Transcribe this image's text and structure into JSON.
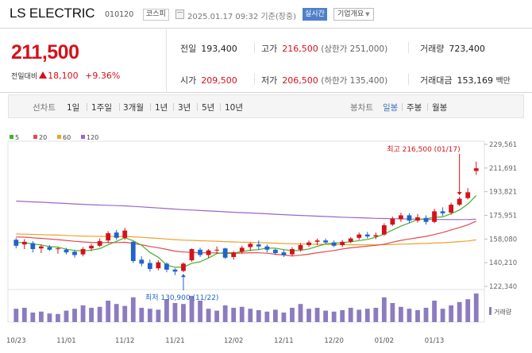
{
  "header": {
    "name": "LS ELECTRIC",
    "code": "010120",
    "market": "코스피",
    "timestamp": "2025.01.17 09:32 기준(장중)",
    "realtime_label": "실시간",
    "company_label": "기업개요"
  },
  "quote": {
    "price": "211,500",
    "change_label": "전일대비",
    "change": "18,100",
    "change_pct": "+9.36%",
    "prev_label": "전일",
    "prev": "193,400",
    "high_label": "고가",
    "high": "216,500",
    "upper_limit": "(상한가 251,000)",
    "volume_label": "거래량",
    "volume": "723,400",
    "open_label": "시가",
    "open": "209,500",
    "low_label": "저가",
    "low": "206,500",
    "lower_limit": "(하한가 135,400)",
    "value_label": "거래대금",
    "value": "153,169",
    "value_unit": "백만"
  },
  "tabs": {
    "line_header": "선차트",
    "line_tabs": [
      "1일",
      "1주일",
      "3개월",
      "1년",
      "3년",
      "5년",
      "10년"
    ],
    "candle_header": "봉차트",
    "candle_tabs": [
      "일봉",
      "주봉",
      "월봉"
    ],
    "active_candle": "일봉"
  },
  "colors": {
    "up": "#d4121a",
    "down": "#1f64c8",
    "ma5": "#44b02c",
    "ma20": "#e5494d",
    "ma60": "#f0a030",
    "ma120": "#9a66c8",
    "volume": "#8c7bc0"
  },
  "chart_data": {
    "type": "candlestick",
    "legend": [
      "5",
      "20",
      "60",
      "120"
    ],
    "y_ticks": [
      "229,561",
      "211,691",
      "193,821",
      "175,951",
      "158,080",
      "140,210",
      "122,340"
    ],
    "ylim": [
      122340,
      229561
    ],
    "x_labels": [
      "10/23",
      "11/01",
      "11/12",
      "11/21",
      "12/02",
      "12/11",
      "12/20",
      "01/02",
      "01/13"
    ],
    "x_label_index": [
      0,
      6,
      13,
      19,
      26,
      32,
      38,
      44,
      50
    ],
    "volume_label": "거래량",
    "high_annotation": "최고 216,500 (01/17)",
    "low_annotation": "최저 130,900 (11/22)",
    "high_index": 53,
    "low_index": 20,
    "candles": [
      {
        "o": 157500,
        "h": 159000,
        "l": 151000,
        "c": 153000
      },
      {
        "o": 154000,
        "h": 158000,
        "l": 150500,
        "c": 156000
      },
      {
        "o": 155000,
        "h": 156500,
        "l": 148000,
        "c": 150500
      },
      {
        "o": 151000,
        "h": 154000,
        "l": 147500,
        "c": 152500
      },
      {
        "o": 152000,
        "h": 153500,
        "l": 149000,
        "c": 150000
      },
      {
        "o": 150500,
        "h": 152000,
        "l": 147000,
        "c": 151000
      },
      {
        "o": 150000,
        "h": 151500,
        "l": 146500,
        "c": 148000
      },
      {
        "o": 148500,
        "h": 150000,
        "l": 144000,
        "c": 146000
      },
      {
        "o": 146500,
        "h": 152000,
        "l": 145000,
        "c": 150500
      },
      {
        "o": 151000,
        "h": 154500,
        "l": 149000,
        "c": 153000
      },
      {
        "o": 153000,
        "h": 158500,
        "l": 152000,
        "c": 156500
      },
      {
        "o": 157000,
        "h": 164000,
        "l": 155000,
        "c": 162500
      },
      {
        "o": 163000,
        "h": 165000,
        "l": 157500,
        "c": 159000
      },
      {
        "o": 159000,
        "h": 166500,
        "l": 157500,
        "c": 164500
      },
      {
        "o": 156000,
        "h": 156500,
        "l": 140000,
        "c": 141500
      },
      {
        "o": 142500,
        "h": 145000,
        "l": 137500,
        "c": 139500
      },
      {
        "o": 140000,
        "h": 142500,
        "l": 133500,
        "c": 135500
      },
      {
        "o": 136000,
        "h": 142000,
        "l": 134500,
        "c": 140500
      },
      {
        "o": 139500,
        "h": 140500,
        "l": 133000,
        "c": 135000
      },
      {
        "o": 135000,
        "h": 136000,
        "l": 130900,
        "c": 133500
      },
      {
        "o": 134000,
        "h": 140500,
        "l": 133000,
        "c": 139500
      },
      {
        "o": 142000,
        "h": 151000,
        "l": 141000,
        "c": 150500
      },
      {
        "o": 150000,
        "h": 151500,
        "l": 144500,
        "c": 146000
      },
      {
        "o": 146000,
        "h": 150500,
        "l": 144000,
        "c": 149500
      },
      {
        "o": 149500,
        "h": 152500,
        "l": 147000,
        "c": 150000
      },
      {
        "o": 151000,
        "h": 151500,
        "l": 143000,
        "c": 144000
      },
      {
        "o": 144500,
        "h": 149000,
        "l": 142500,
        "c": 148000
      },
      {
        "o": 148500,
        "h": 153000,
        "l": 147000,
        "c": 151500
      },
      {
        "o": 152000,
        "h": 155500,
        "l": 149000,
        "c": 154500
      },
      {
        "o": 154000,
        "h": 157000,
        "l": 150000,
        "c": 152500
      },
      {
        "o": 152500,
        "h": 154000,
        "l": 148000,
        "c": 150000
      },
      {
        "o": 150000,
        "h": 151000,
        "l": 146000,
        "c": 147500
      },
      {
        "o": 148000,
        "h": 150000,
        "l": 144500,
        "c": 146000
      },
      {
        "o": 146500,
        "h": 152000,
        "l": 145000,
        "c": 150500
      },
      {
        "o": 150000,
        "h": 155000,
        "l": 148500,
        "c": 153500
      },
      {
        "o": 153500,
        "h": 157000,
        "l": 152000,
        "c": 155500
      },
      {
        "o": 156000,
        "h": 158500,
        "l": 153500,
        "c": 157000
      },
      {
        "o": 157000,
        "h": 158500,
        "l": 154500,
        "c": 155500
      },
      {
        "o": 155500,
        "h": 157000,
        "l": 152000,
        "c": 153000
      },
      {
        "o": 153500,
        "h": 157500,
        "l": 152000,
        "c": 156000
      },
      {
        "o": 156000,
        "h": 159500,
        "l": 155000,
        "c": 158500
      },
      {
        "o": 159000,
        "h": 163000,
        "l": 157500,
        "c": 161500
      },
      {
        "o": 161500,
        "h": 163500,
        "l": 158500,
        "c": 160000
      },
      {
        "o": 160000,
        "h": 163000,
        "l": 158000,
        "c": 161000
      },
      {
        "o": 161500,
        "h": 170000,
        "l": 160500,
        "c": 168500
      },
      {
        "o": 169000,
        "h": 175000,
        "l": 168000,
        "c": 173500
      },
      {
        "o": 173000,
        "h": 178000,
        "l": 171000,
        "c": 176000
      },
      {
        "o": 176000,
        "h": 177500,
        "l": 170000,
        "c": 172000
      },
      {
        "o": 172000,
        "h": 177000,
        "l": 170500,
        "c": 174500
      },
      {
        "o": 174000,
        "h": 176000,
        "l": 169000,
        "c": 171000
      },
      {
        "o": 171000,
        "h": 181000,
        "l": 170000,
        "c": 179000
      },
      {
        "o": 179000,
        "h": 182000,
        "l": 175500,
        "c": 177500
      },
      {
        "o": 178000,
        "h": 185500,
        "l": 176500,
        "c": 184000
      },
      {
        "o": 184000,
        "h": 190000,
        "l": 183000,
        "c": 188500
      },
      {
        "o": 189000,
        "h": 196500,
        "l": 188000,
        "c": 193400
      },
      {
        "o": 209500,
        "h": 216500,
        "l": 206500,
        "c": 211500
      }
    ],
    "volume": [
      28,
      30,
      20,
      22,
      18,
      17,
      24,
      28,
      35,
      30,
      32,
      45,
      38,
      34,
      52,
      30,
      28,
      26,
      48,
      40,
      38,
      55,
      45,
      28,
      24,
      35,
      30,
      32,
      28,
      25,
      22,
      26,
      20,
      30,
      38,
      28,
      30,
      24,
      22,
      25,
      30,
      26,
      28,
      30,
      52,
      40,
      32,
      28,
      25,
      30,
      45,
      28,
      35,
      42,
      48,
      60
    ]
  }
}
